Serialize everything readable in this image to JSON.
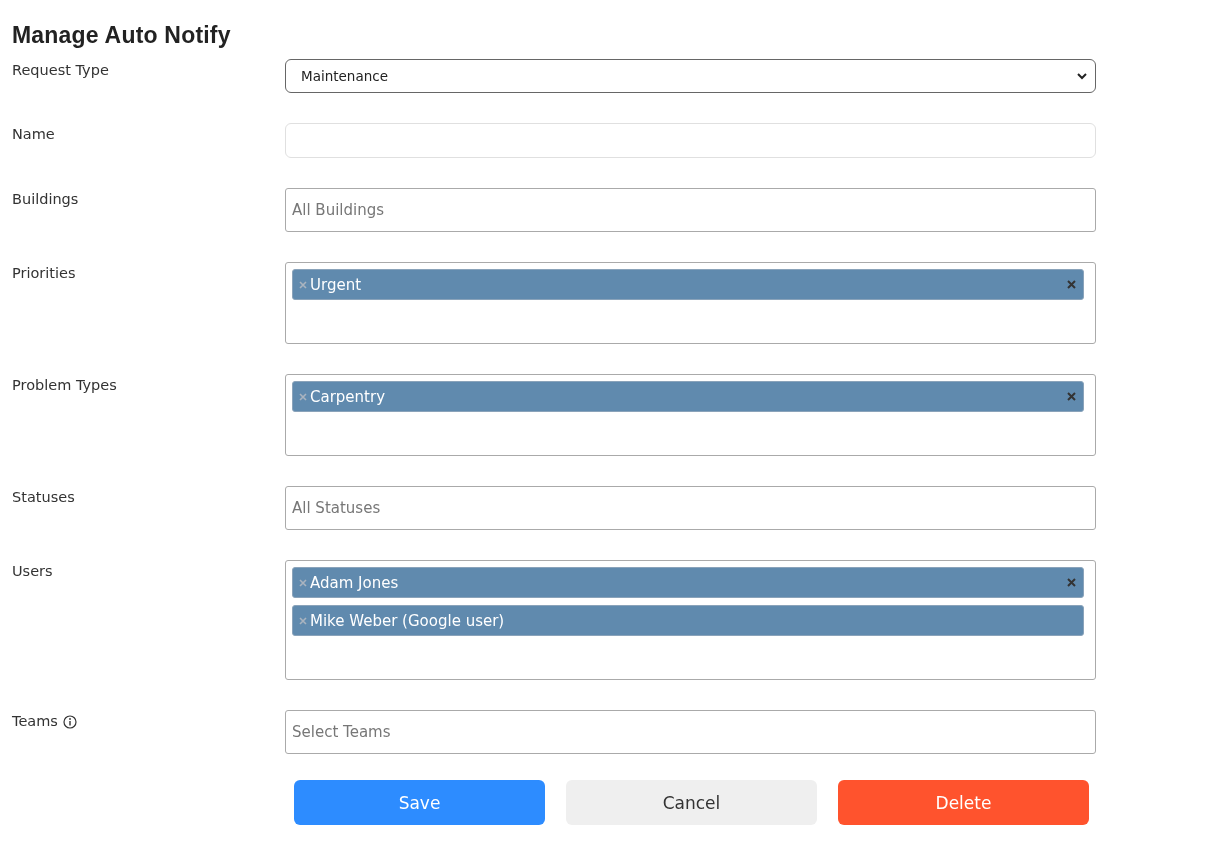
{
  "title": "Manage Auto Notify",
  "fields": [
    {
      "label": "Request Type",
      "kind": "select",
      "value": "Maintenance"
    },
    {
      "label": "Name",
      "kind": "text"
    },
    {
      "label": "Buildings",
      "kind": "multi",
      "placeholder": "All Buildings"
    },
    {
      "label": "Priorities",
      "kind": "multi",
      "tags": [
        "Urgent"
      ]
    },
    {
      "label": "Problem Types",
      "kind": "multi",
      "tags": [
        "Carpentry"
      ]
    },
    {
      "label": "Statuses",
      "kind": "multi",
      "placeholder": "All Statuses"
    },
    {
      "label": "Users",
      "kind": "multi",
      "tags": [
        "Adam Jones",
        "Mike Weber (Google user)"
      ]
    },
    {
      "label": "Teams",
      "kind": "multi",
      "info_icon": true,
      "placeholder": "Select Teams"
    }
  ],
  "buttons": [
    {
      "label": "Save",
      "kind": "primary"
    },
    {
      "label": "Cancel",
      "kind": "secondary"
    },
    {
      "label": "Delete",
      "kind": "danger"
    }
  ]
}
